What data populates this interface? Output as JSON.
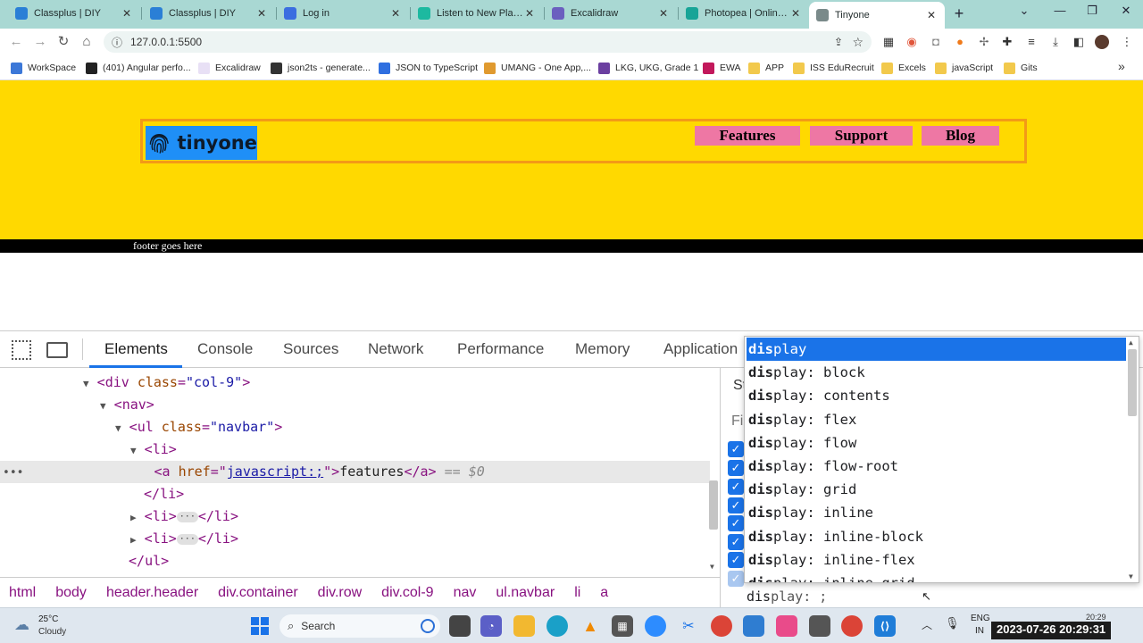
{
  "browser": {
    "tabs": [
      {
        "title": "Classplus | DIY",
        "icon": "classplus-icon",
        "color": "#2a7fd6"
      },
      {
        "title": "Classplus | DIY",
        "icon": "classplus-icon",
        "color": "#2a7fd6"
      },
      {
        "title": "Log in",
        "icon": "k-icon",
        "color": "#3b6ee0"
      },
      {
        "title": "Listen to New Playlist",
        "icon": "v-icon",
        "color": "#1db9a0"
      },
      {
        "title": "Excalidraw",
        "icon": "excalidraw-icon",
        "color": "#6b5fbf"
      },
      {
        "title": "Photopea | Online Photo",
        "icon": "photopea-icon",
        "color": "#18a497"
      },
      {
        "title": "Tinyone",
        "icon": "globe-icon",
        "color": "#7a8a8a"
      }
    ],
    "url": "127.0.0.1:5500",
    "bookmarks": [
      {
        "label": "WorkSpace",
        "color": "#3c78d8"
      },
      {
        "label": "(401) Angular perfo...",
        "color": "#222222"
      },
      {
        "label": "Excalidraw",
        "color": "#e8e0f5"
      },
      {
        "label": "json2ts - generate...",
        "color": "#333333"
      },
      {
        "label": "JSON to TypeScript",
        "color": "#2f6fe0"
      },
      {
        "label": "UMANG - One App,...",
        "color": "#e09a2f"
      },
      {
        "label": "LKG, UKG, Grade 1",
        "color": "#6b3fa0"
      },
      {
        "label": "EWA",
        "color": "#c2185b"
      },
      {
        "label": "APP",
        "color": "#f2c94c"
      },
      {
        "label": "ISS EduRecruit",
        "color": "#f2c94c"
      },
      {
        "label": "Excels",
        "color": "#f2c94c"
      },
      {
        "label": "javaScript",
        "color": "#f2c94c"
      },
      {
        "label": "Gits",
        "color": "#f2c94c"
      }
    ]
  },
  "page": {
    "logo_text": "tinyone",
    "nav": [
      "Features",
      "Support",
      "Blog"
    ],
    "footer": "footer goes here"
  },
  "devtools": {
    "tabs": [
      "Elements",
      "Console",
      "Sources",
      "Network",
      "Performance",
      "Memory",
      "Application"
    ],
    "dom": {
      "l1_tag": "div",
      "l1_attr": "class",
      "l1_val": "\"col-9\"",
      "l2_tag": "nav",
      "l3_tag": "ul",
      "l3_attr": "class",
      "l3_val": "\"navbar\"",
      "l4_tag": "li",
      "l5_tag": "a",
      "l5_attr": "href",
      "l5_val": "javascript:;",
      "l5_text": "features",
      "l5_sel": "== $0",
      "l6_close": "li",
      "l9_close": "ul"
    },
    "breadcrumbs": [
      "html",
      "body",
      "header.header",
      "div.container",
      "div.row",
      "div.col-9",
      "nav",
      "ul.navbar",
      "li",
      "a"
    ],
    "styles_partial_1": "St",
    "styles_partial_2": "Fil",
    "autocomplete": {
      "typed": "dis",
      "items": [
        {
          "match": "dis",
          "rest": "play"
        },
        {
          "match": "dis",
          "rest": "play: block"
        },
        {
          "match": "dis",
          "rest": "play: contents"
        },
        {
          "match": "dis",
          "rest": "play: flex"
        },
        {
          "match": "dis",
          "rest": "play: flow"
        },
        {
          "match": "dis",
          "rest": "play: flow-root"
        },
        {
          "match": "dis",
          "rest": "play: grid"
        },
        {
          "match": "dis",
          "rest": "play: inline"
        },
        {
          "match": "dis",
          "rest": "play: inline-block"
        },
        {
          "match": "dis",
          "rest": "play: inline-flex"
        },
        {
          "match": "dis",
          "rest": "play: inline-grid"
        }
      ],
      "input_rest": "play: ;"
    }
  },
  "taskbar": {
    "weather_temp": "25°C",
    "weather_desc": "Cloudy",
    "search_placeholder": "Search",
    "lang_1": "ENG",
    "lang_2": "IN",
    "clock_small": "20:29",
    "timestamp": "2023-07-26  20:29:31"
  }
}
